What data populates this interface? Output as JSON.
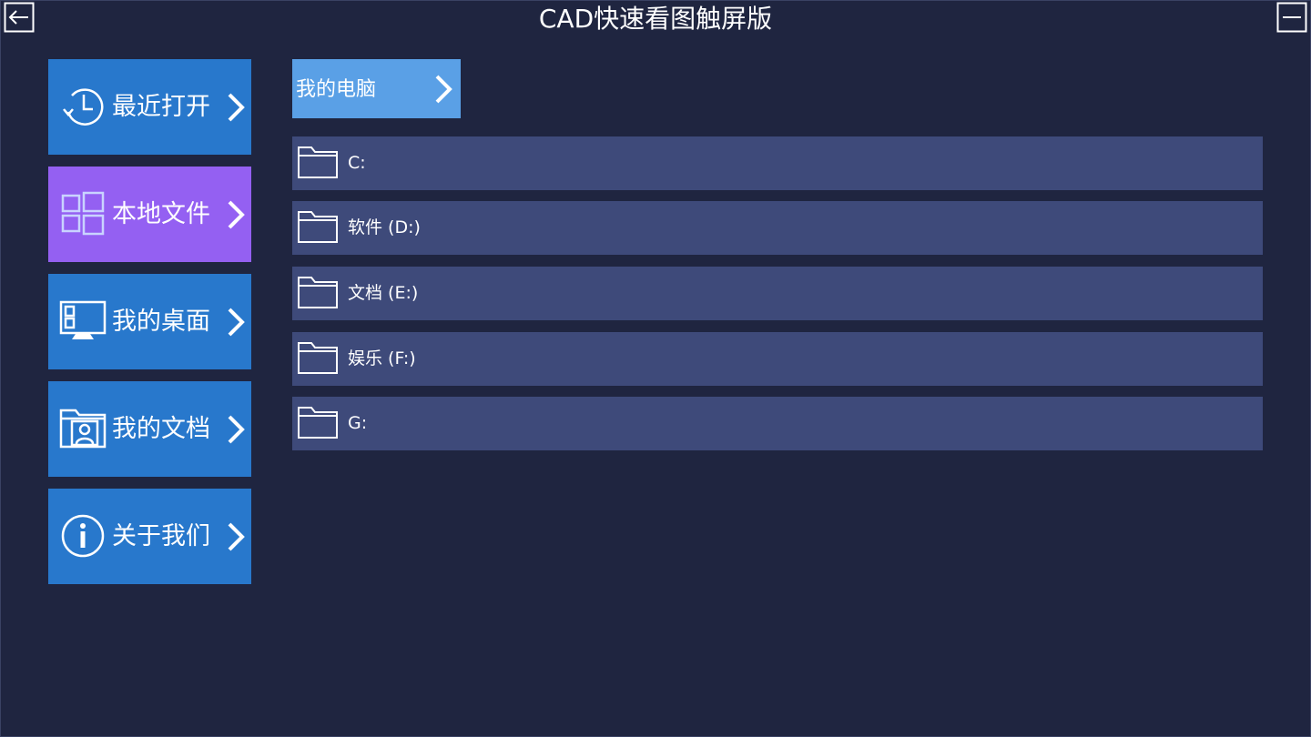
{
  "window": {
    "title": "CAD快速看图触屏版"
  },
  "sidebar": {
    "items": [
      {
        "label": "最近打开",
        "icon": "clock-history-icon",
        "active": false
      },
      {
        "label": "本地文件",
        "icon": "windows-logo-icon",
        "active": true
      },
      {
        "label": "我的桌面",
        "icon": "desktop-monitor-icon",
        "active": false
      },
      {
        "label": "我的文档",
        "icon": "user-folder-icon",
        "active": false
      },
      {
        "label": "关于我们",
        "icon": "info-icon",
        "active": false
      }
    ]
  },
  "breadcrumb": {
    "label": "我的电脑"
  },
  "drives": [
    {
      "label": "C:"
    },
    {
      "label": "软件 (D:)"
    },
    {
      "label": "文档 (E:)"
    },
    {
      "label": "娱乐 (F:)"
    },
    {
      "label": "G:"
    }
  ],
  "colors": {
    "background": "#1f2540",
    "tile_blue": "#2878cc",
    "tile_active_purple": "#9460f2",
    "breadcrumb_blue": "#5aa0e6",
    "drive_row": "#3e4a7a"
  }
}
